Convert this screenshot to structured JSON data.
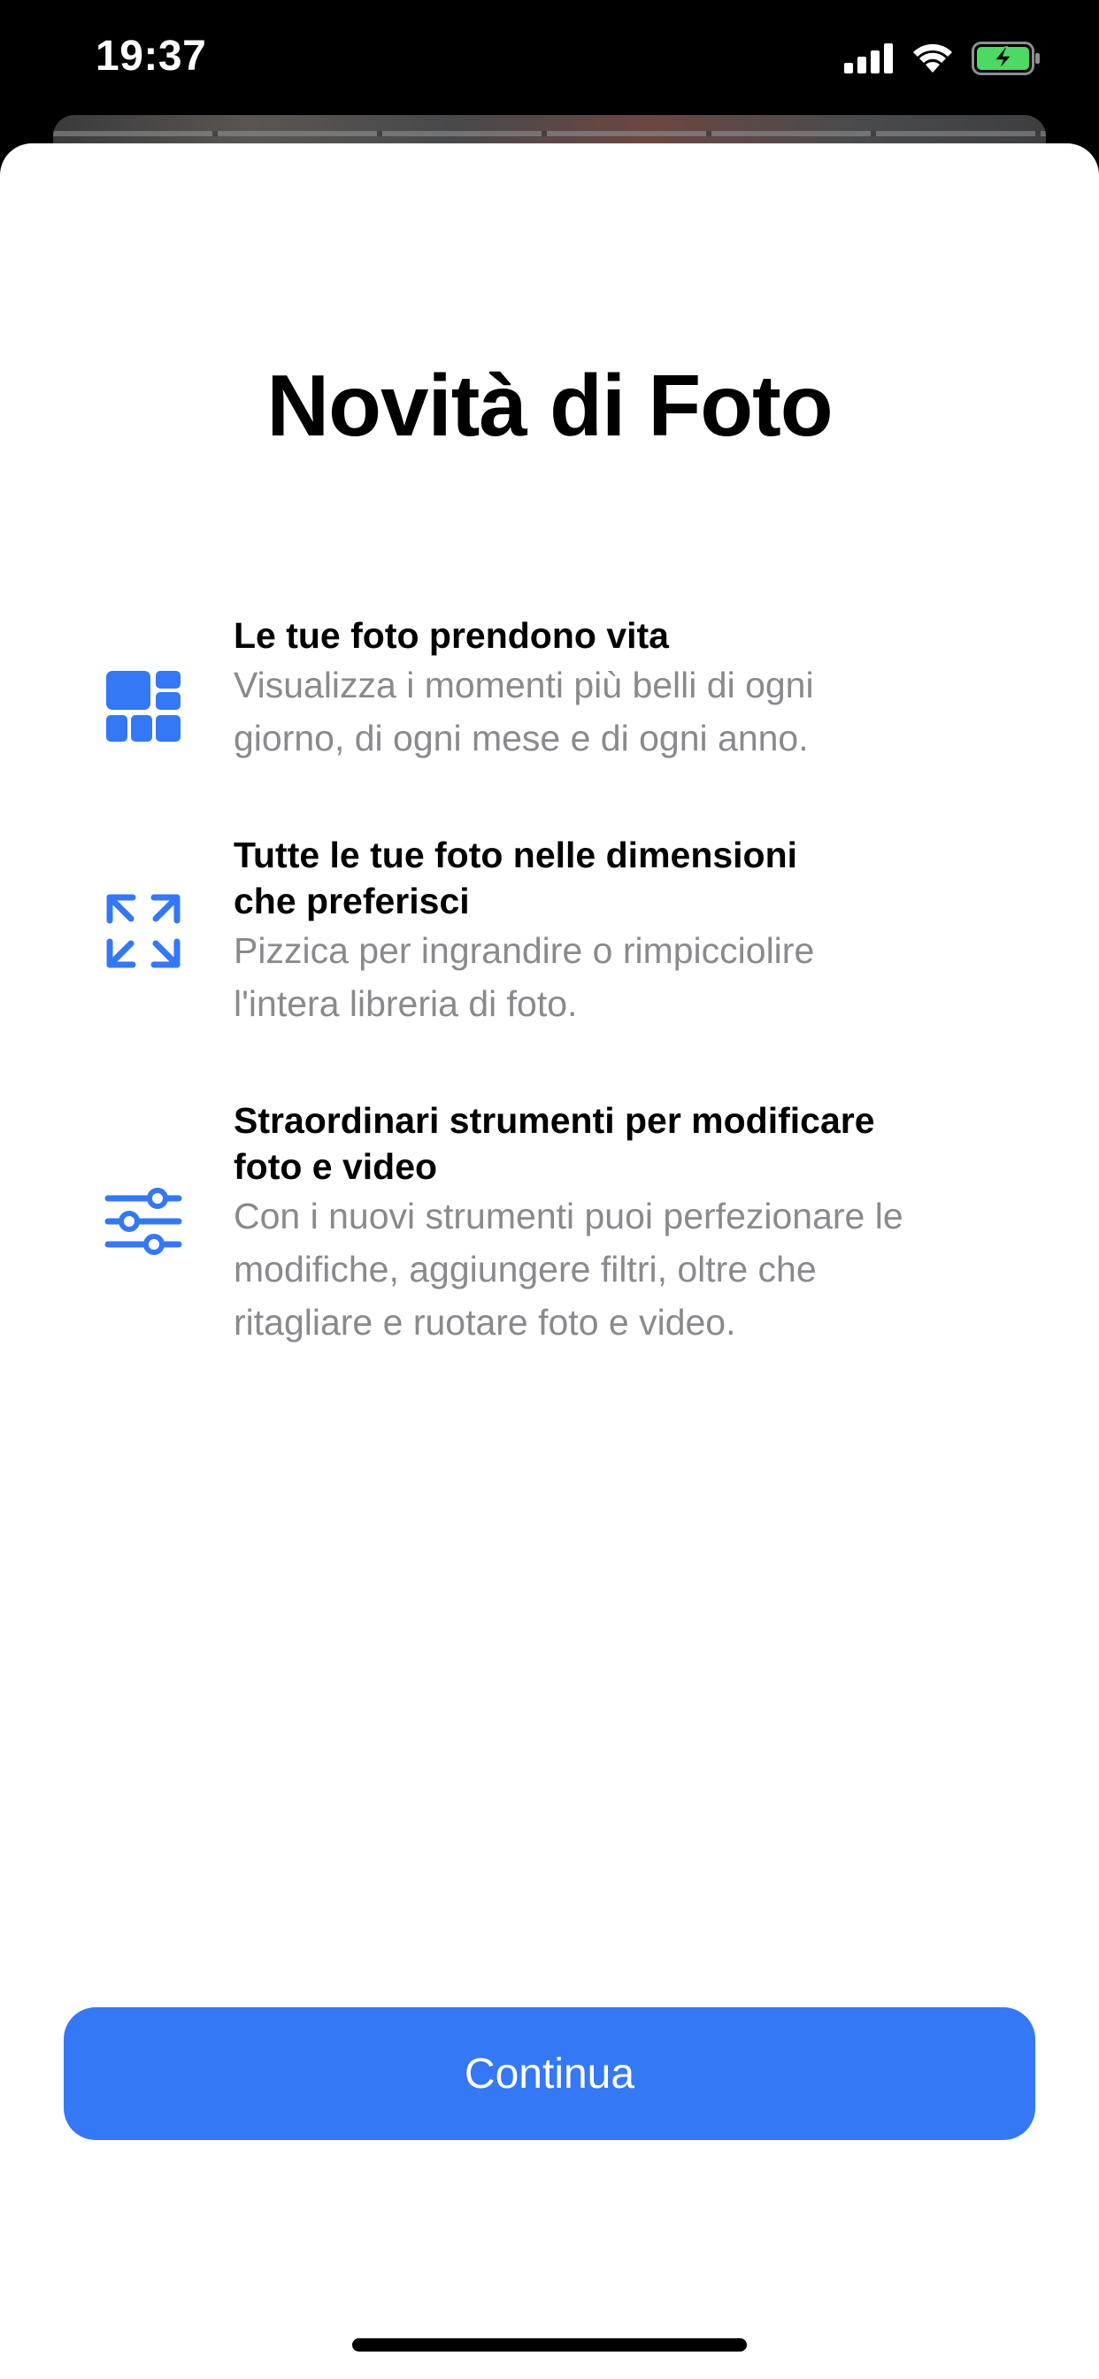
{
  "status_bar": {
    "time": "19:37",
    "battery_charging": true,
    "icons": [
      "cellular-signal-icon",
      "wifi-icon",
      "battery-charging-icon"
    ]
  },
  "sheet": {
    "title": "Novità di Foto",
    "features": [
      {
        "icon": "grid-layout-icon",
        "heading": "Le tue foto prendono vita",
        "description_lines": [
          "Visualizza i momenti più belli di ogni",
          "giorno, di ogni mese e di ogni anno."
        ]
      },
      {
        "icon": "expand-arrows-icon",
        "heading_lines": [
          "Tutte le tue foto nelle dimensioni",
          "che preferisci"
        ],
        "description_lines": [
          "Pizzica per ingrandire o rimpicciolire",
          "l'intera libreria di foto."
        ]
      },
      {
        "icon": "sliders-icon",
        "heading_lines": [
          "Straordinari strumenti per modificare",
          "foto e video"
        ],
        "description_lines": [
          "Con i nuovi strumenti puoi perfezionare le",
          "modifiche, aggiungere filtri, oltre che",
          "ritagliare e ruotare foto e video."
        ]
      }
    ],
    "continue_label": "Continua"
  },
  "colors": {
    "accent": "#3478f6",
    "secondary_text": "#8a8a8e",
    "battery_green": "#4cd964"
  }
}
